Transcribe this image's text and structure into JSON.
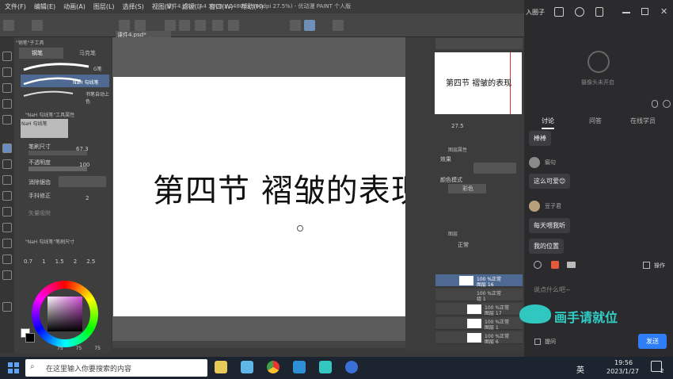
{
  "app": {
    "menu": [
      "文件(F)",
      "编辑(E)",
      "动画(A)",
      "图层(L)",
      "选择(S)",
      "视图(V)",
      "滤镜(I)",
      "窗口(W)",
      "帮助(H)"
    ],
    "document_title": "课件4.psd* (A4 3508 x 2480px 300dpi 27.5%) - 优动漫 PAINT 个人版",
    "tab_label": "课件4.psd*"
  },
  "left_panel": {
    "subtool_header": "\"钢笔\"子工具",
    "subtool_tabs": [
      "钢笔",
      "马克笔"
    ],
    "brushes": [
      "G笔",
      "NaH 勾线笔",
      "书笔自动上色"
    ],
    "tool_property_header": "\"NaH 勾线笔\"工具属性",
    "tool_property_name": "NaH 勾线笔",
    "brush_size_label": "笔刷尺寸",
    "brush_size_value": "67.3",
    "opacity_label": "不透明度",
    "opacity_value": "100",
    "antialias_label": "消除锯齿",
    "stabilize_label": "手抖修正",
    "stabilize_value": "2",
    "vector_snap_label": "矢量吸附",
    "size_panel_header": "\"NaH 勾线笔\"笔刷尺寸",
    "size_presets": [
      "0.7",
      "1",
      "1.5",
      "2",
      "2.5"
    ],
    "color_values": [
      "75",
      "75",
      "75"
    ]
  },
  "canvas": {
    "heading": "第四节  褶皱的表现",
    "zoom": "27.5"
  },
  "right_panel": {
    "navigator_text": "第四节  褶皱的表现",
    "effect_header": "图层属性",
    "effect_label": "效果",
    "color_mode_label": "颜色模式",
    "color_mode_value": "彩色",
    "layer_panel_header": "图层",
    "blend_mode": "正常",
    "layers": [
      {
        "line1": "100 %正常",
        "line2": "图层 16"
      },
      {
        "line1": "100 %正常",
        "line2": "组 1"
      },
      {
        "line1": "100 %正常",
        "line2": "图层 17"
      },
      {
        "line1": "100 %正常",
        "line2": "图层 1"
      },
      {
        "line1": "100 %正常",
        "line2": "图层 6"
      }
    ]
  },
  "chat": {
    "host": "入圈子",
    "camera_status": "摄像头未开启",
    "tabs": [
      "讨论",
      "问答",
      "在线学员"
    ],
    "messages": [
      {
        "user": "",
        "text": "棒棒"
      },
      {
        "user": "瘸句",
        "text": "这么可爱😊"
      },
      {
        "user": "豆子君",
        "text": "每天喂我听"
      },
      {
        "user": "",
        "text": "我的位置"
      }
    ],
    "input_placeholder": "说点什么吧~",
    "action_label": "操作",
    "watermark": "画手请就位",
    "anonymous_label": "提问",
    "send_label": "发送"
  },
  "taskbar": {
    "search_placeholder": "在这里输入你要搜索的内容",
    "ime": "英",
    "time": "19:56",
    "date": "2023/1/27",
    "notification_count": "2"
  },
  "colors": {
    "accent_blue": "#2f7ef5",
    "chat_bg": "#2b2b2d",
    "canvas_bg": "#5c5c5c"
  }
}
